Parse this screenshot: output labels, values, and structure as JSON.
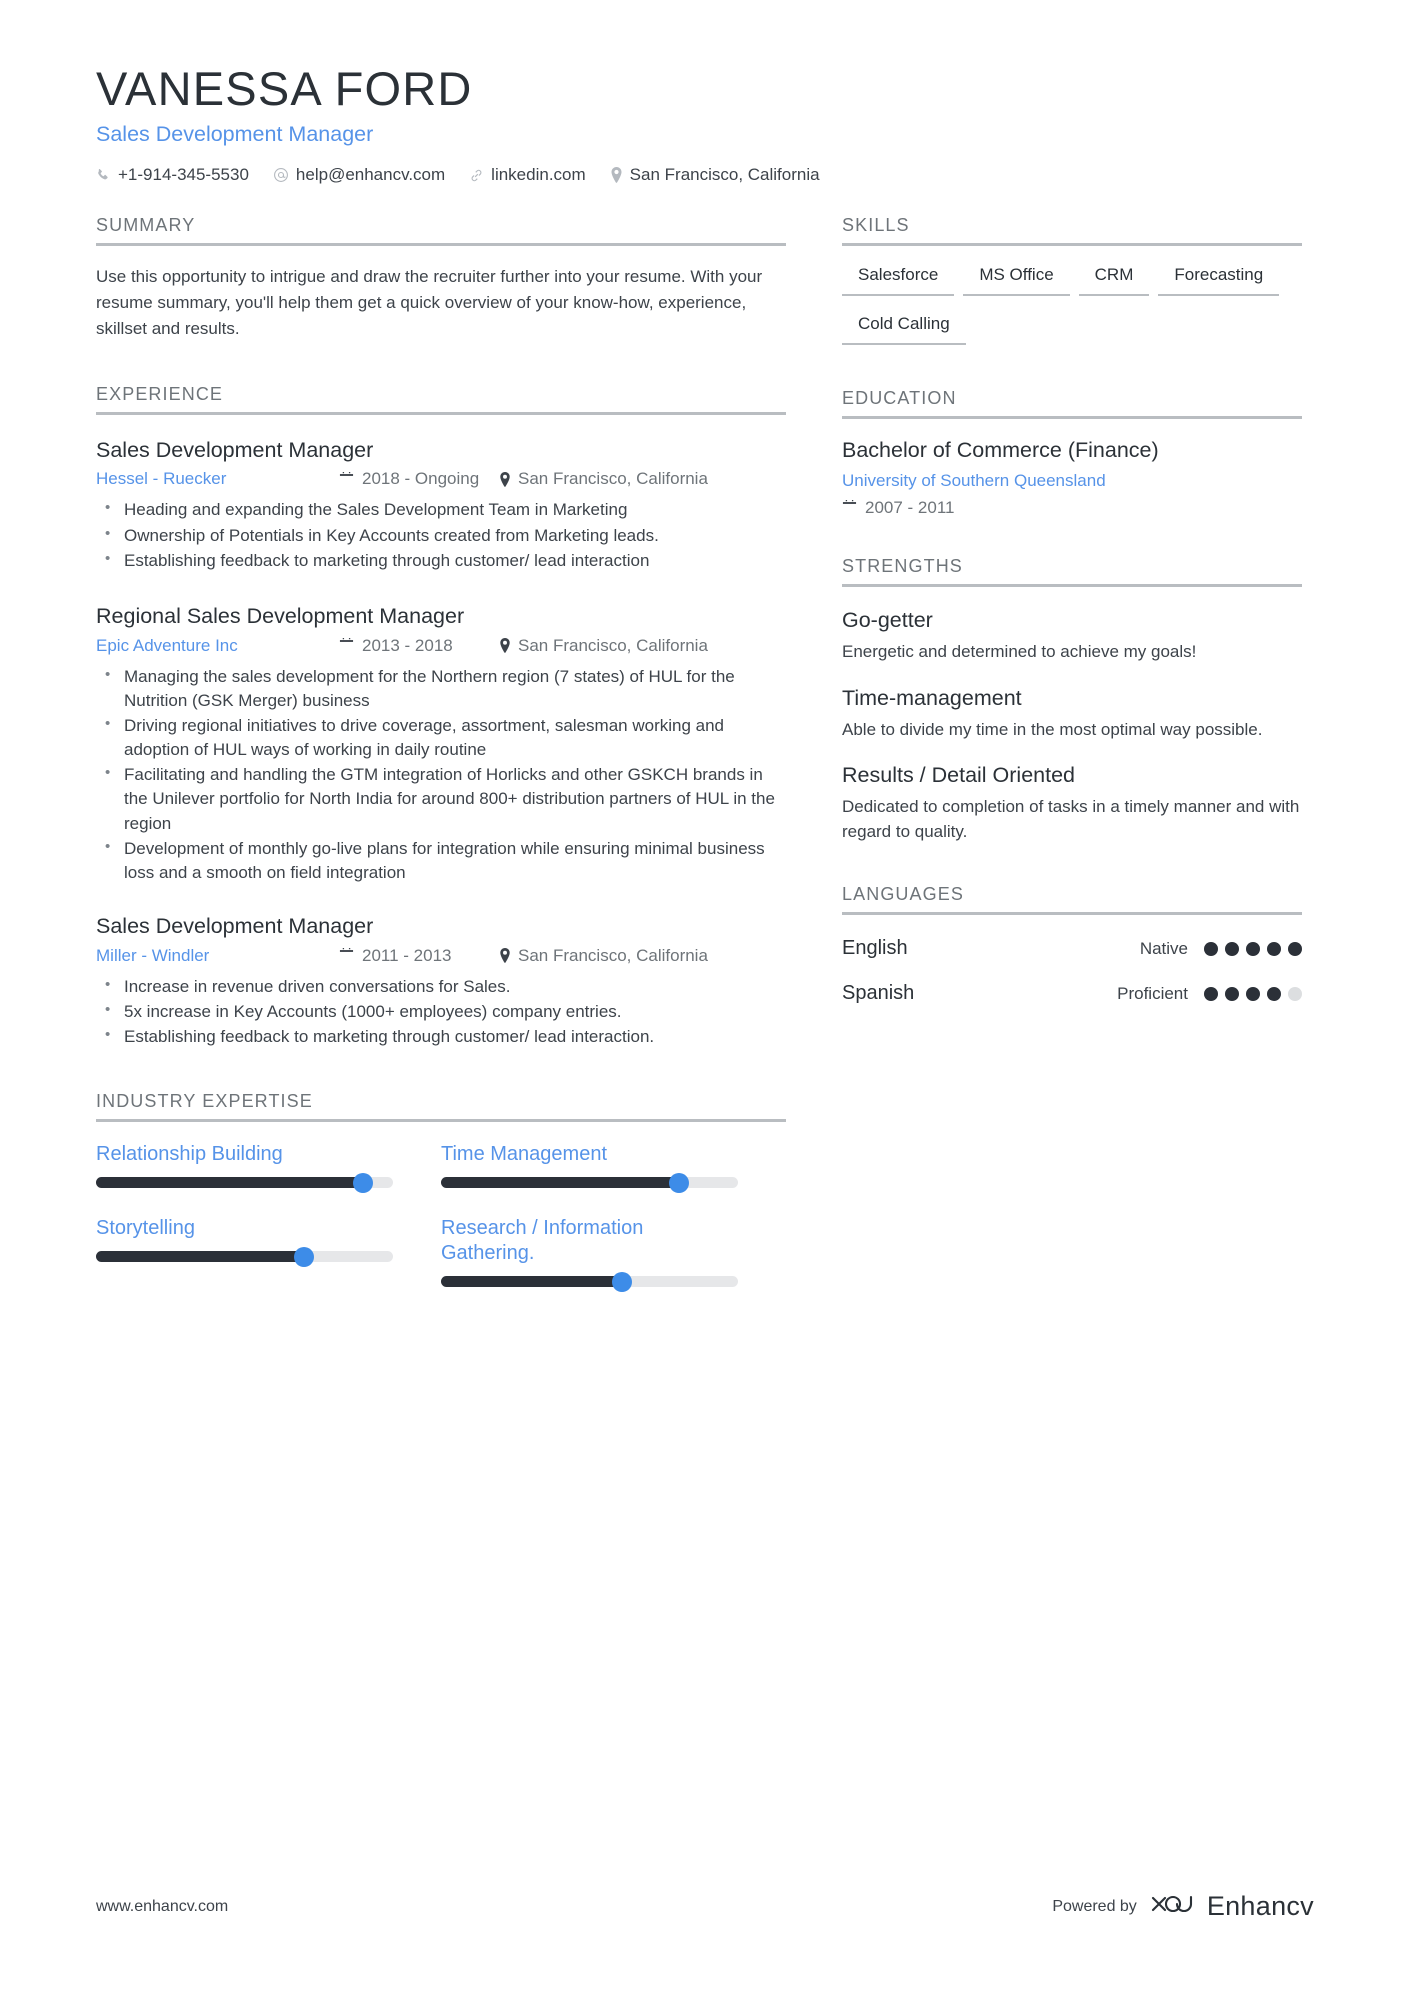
{
  "header": {
    "name": "VANESSA FORD",
    "role": "Sales Development Manager",
    "contacts": [
      {
        "icon": "phone-icon",
        "text": "+1-914-345-5530"
      },
      {
        "icon": "email-icon",
        "text": "help@enhancv.com"
      },
      {
        "icon": "link-icon",
        "text": "linkedin.com"
      },
      {
        "icon": "location-icon",
        "text": "San Francisco, California"
      }
    ]
  },
  "summary": {
    "title": "SUMMARY",
    "text": "Use this opportunity to intrigue and draw the recruiter further into your resume. With your resume summary, you'll help them get a quick overview of your know-how, experience, skillset and results."
  },
  "experience": {
    "title": "EXPERIENCE",
    "jobs": [
      {
        "title": "Sales Development Manager",
        "company": "Hessel - Ruecker",
        "date": "2018 - Ongoing",
        "location": "San Francisco, California",
        "bullets": [
          "Heading and expanding the Sales Development Team in Marketing",
          "Ownership of Potentials in Key Accounts created from Marketing leads.",
          "Establishing feedback to marketing through customer/ lead interaction"
        ]
      },
      {
        "title": "Regional Sales Development Manager",
        "company": "Epic Adventure Inc",
        "date": "2013 - 2018",
        "location": "San Francisco, California",
        "bullets": [
          "Managing the sales development for the Northern region (7 states) of HUL for the Nutrition (GSK Merger) business",
          "Driving regional initiatives to drive coverage, assortment, salesman working and adoption of HUL ways of working in daily routine",
          "Facilitating and handling the GTM integration of Horlicks and other GSKCH brands in the Unilever portfolio for North India for around 800+ distribution partners of HUL in the region",
          "Development of monthly go-live plans for integration while ensuring minimal business loss and a smooth on field integration"
        ]
      },
      {
        "title": "Sales Development Manager",
        "company": "Miller - Windler",
        "date": "2011 - 2013",
        "location": "San Francisco, California",
        "bullets": [
          "Increase in revenue driven conversations for Sales.",
          "5x increase in Key Accounts (1000+ employees) company entries.",
          "Establishing feedback to marketing through customer/ lead interaction."
        ]
      }
    ]
  },
  "industry_expertise": {
    "title": "INDUSTRY EXPERTISE",
    "items": [
      {
        "label": "Relationship Building",
        "percent": 90
      },
      {
        "label": "Time Management",
        "percent": 80
      },
      {
        "label": "Storytelling",
        "percent": 70
      },
      {
        "label": "Research / Information Gathering.",
        "percent": 61
      }
    ]
  },
  "skills": {
    "title": "SKILLS",
    "items": [
      "Salesforce",
      "MS Office",
      "CRM",
      "Forecasting",
      "Cold Calling"
    ]
  },
  "education": {
    "title": "EDUCATION",
    "entries": [
      {
        "degree": "Bachelor of Commerce (Finance)",
        "school": "University of Southern Queensland",
        "date": "2007 - 2011"
      }
    ]
  },
  "strengths": {
    "title": "STRENGTHS",
    "items": [
      {
        "title": "Go-getter",
        "description": "Energetic and determined to achieve my goals!"
      },
      {
        "title": "Time-management",
        "description": "Able to divide my time in the most optimal way possible."
      },
      {
        "title": "Results / Detail Oriented",
        "description": "Dedicated to completion of tasks in a timely manner and with regard to quality."
      }
    ]
  },
  "languages": {
    "title": "LANGUAGES",
    "items": [
      {
        "name": "English",
        "level": "Native",
        "filled": 5,
        "total": 5
      },
      {
        "name": "Spanish",
        "level": "Proficient",
        "filled": 4,
        "total": 5
      }
    ]
  },
  "footer": {
    "website": "www.enhancv.com",
    "powered_by": "Powered by",
    "brand": "Enhancv"
  },
  "colors": {
    "accent": "#5693e8",
    "slider_fill": "#2b3038",
    "slider_track": "#e6e7e9",
    "knob": "#3d8ce8",
    "rule": "#b9bdc1",
    "text": "#3d434a",
    "heading": "#2b3137",
    "muted": "#6e7479"
  }
}
